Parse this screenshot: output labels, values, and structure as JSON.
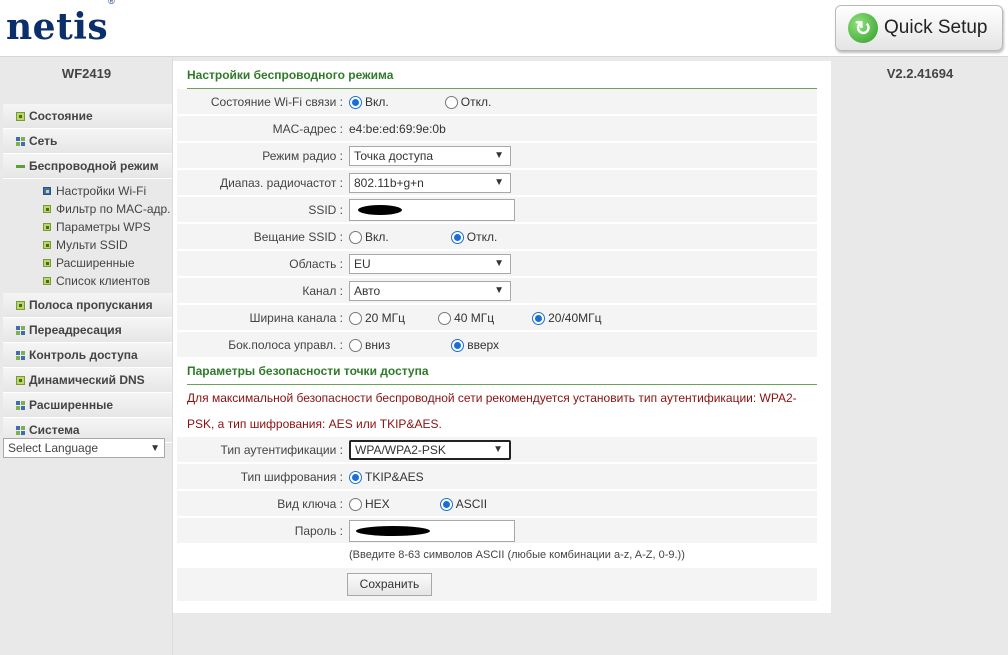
{
  "header": {
    "logo": "netis",
    "trademark": "®",
    "quick_setup_label": "Quick Setup"
  },
  "sidebar": {
    "model": "WF2419",
    "menu": [
      {
        "label": "Состояние",
        "icon": "status-icon"
      },
      {
        "label": "Сеть",
        "icon": "network-icon"
      },
      {
        "label": "Беспроводной режим",
        "icon": "collapse-icon",
        "expanded": true,
        "subitems": [
          {
            "label": "Настройки Wi-Fi",
            "active": true
          },
          {
            "label": "Фильтр по MAC-адр."
          },
          {
            "label": "Параметры WPS"
          },
          {
            "label": "Мульти SSID"
          },
          {
            "label": "Расширенные"
          },
          {
            "label": "Список клиентов"
          }
        ]
      },
      {
        "label": "Полоса пропускания"
      },
      {
        "label": "Переадресация"
      },
      {
        "label": "Контроль доступа"
      },
      {
        "label": "Динамический DNS"
      },
      {
        "label": "Расширенные"
      },
      {
        "label": "Система"
      }
    ],
    "language_select": "Select Language"
  },
  "version": "V2.2.41694",
  "wireless": {
    "title": "Настройки беспроводного режима",
    "wifi_status_label": "Состояние Wi-Fi связи :",
    "wifi_on": "Вкл.",
    "wifi_off": "Откл.",
    "mac_label": "MAC-адрес :",
    "mac_value": "e4:be:ed:69:9e:0b",
    "radio_mode_label": "Режим радио :",
    "radio_mode_value": "Точка доступа",
    "band_label": "Диапаз. радиочастот :",
    "band_value": "802.11b+g+n",
    "ssid_label": "SSID :",
    "broadcast_label": "Вещание SSID :",
    "broadcast_on": "Вкл.",
    "broadcast_off": "Откл.",
    "region_label": "Область :",
    "region_value": "EU",
    "channel_label": "Канал :",
    "channel_value": "Авто",
    "width_label": "Ширина канала :",
    "width_20": "20 МГц",
    "width_40": "40 МГц",
    "width_2040": "20/40МГц",
    "sideband_label": "Бок.полоса управл. :",
    "sideband_down": "вниз",
    "sideband_up": "вверх"
  },
  "security": {
    "title": "Параметры безопасности точки доступа",
    "warning": "Для максимальной безопасности беспроводной сети рекомендуется установить тип аутентификации: WPA2-PSK, а тип шифрования: AES или TKIP&AES.",
    "auth_label": "Тип аутентификации :",
    "auth_value": "WPA/WPA2-PSK",
    "encryption_label": "Тип шифрования :",
    "encryption_value": "TKIP&AES",
    "key_type_label": "Вид ключа :",
    "key_hex": "HEX",
    "key_ascii": "ASCII",
    "password_label": "Пароль :",
    "password_hint": "(Введите 8-63 символов ASCII (любые комбинации a-z, A-Z, 0-9.))",
    "save_label": "Сохранить"
  },
  "colors": {
    "accent_green": "#2f7b2a",
    "radio_blue": "#1a6fd6",
    "warning_red": "#8a1010"
  }
}
